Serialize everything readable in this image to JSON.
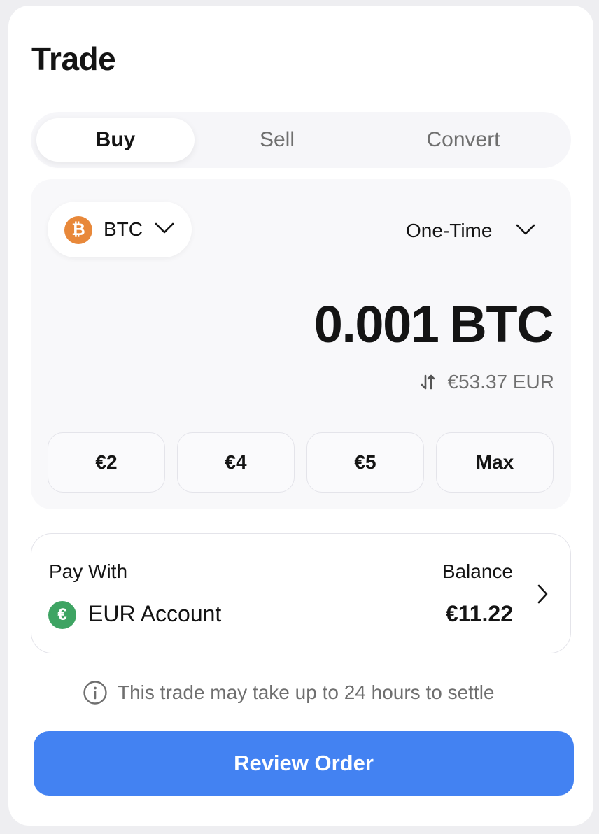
{
  "header": {
    "title": "Trade"
  },
  "tabs": [
    {
      "label": "Buy",
      "active": true
    },
    {
      "label": "Sell",
      "active": false
    },
    {
      "label": "Convert",
      "active": false
    }
  ],
  "order": {
    "asset": {
      "symbol": "BTC",
      "logo_glyph": "₿",
      "icon": "bitcoin-icon",
      "color": "#e8883a"
    },
    "frequency": "One-Time",
    "amount": "0.001",
    "amount_unit": "BTC",
    "fiat_equivalent": "€53.37 EUR",
    "presets": [
      "€2",
      "€4",
      "€5",
      "Max"
    ]
  },
  "pay_with": {
    "label": "Pay With",
    "account": "EUR Account",
    "account_glyph": "€",
    "balance_label": "Balance",
    "balance": "€11.22"
  },
  "notice": {
    "text": "This trade may take up to 24 hours to settle",
    "icon": "info-icon"
  },
  "actions": {
    "review_label": "Review Order"
  },
  "colors": {
    "accent": "#4382f2",
    "btc": "#e8883a",
    "eur": "#3ea463"
  }
}
